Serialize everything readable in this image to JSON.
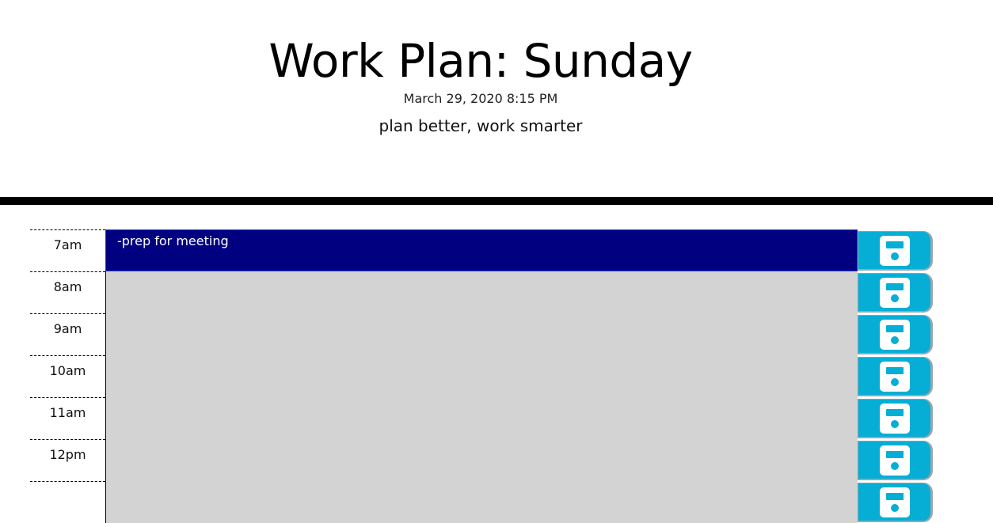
{
  "header": {
    "title": "Work Plan: Sunday",
    "datetime": "March 29, 2020 8:15 PM",
    "tagline": "plan better, work smarter"
  },
  "schedule": [
    {
      "hour": "7am",
      "task": "-prep for meeting",
      "state": "present"
    },
    {
      "hour": "8am",
      "task": "",
      "state": "past"
    },
    {
      "hour": "9am",
      "task": "",
      "state": "past"
    },
    {
      "hour": "10am",
      "task": "",
      "state": "past"
    },
    {
      "hour": "11am",
      "task": "",
      "state": "past"
    },
    {
      "hour": "12pm",
      "task": "",
      "state": "past"
    },
    {
      "hour": "",
      "task": "",
      "state": "past"
    }
  ],
  "icons": {
    "save": "floppy-disk-icon"
  },
  "colors": {
    "present": "#000080",
    "past": "#d3d3d3",
    "save_button": "#06aed5"
  }
}
